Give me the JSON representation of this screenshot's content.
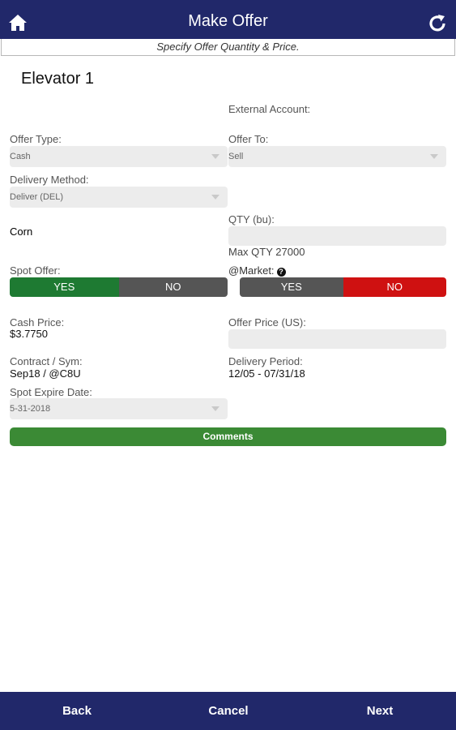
{
  "header": {
    "title": "Make Offer",
    "home_icon": "home-icon",
    "refresh_icon": "refresh-icon"
  },
  "subheader": "Specify Offer Quantity & Price.",
  "location": "Elevator 1",
  "form": {
    "external_account_label": "External Account:",
    "offer_type_label": "Offer Type:",
    "offer_type_value": "Cash",
    "offer_to_label": "Offer To:",
    "offer_to_value": "Sell",
    "delivery_method_label": "Delivery Method:",
    "delivery_method_value": "Deliver (DEL)",
    "commodity": "Corn",
    "qty_label": "QTY (bu):",
    "qty_value": "",
    "max_qty": "Max QTY 27000",
    "spot_offer_label": "Spot Offer:",
    "spot_offer_yes": "YES",
    "spot_offer_no": "NO",
    "market_label": "@Market:",
    "market_yes": "YES",
    "market_no": "NO",
    "cash_price_label": "Cash Price:",
    "cash_price_value": "$3.7750",
    "offer_price_label": "Offer Price (US):",
    "offer_price_value": "",
    "contract_label": "Contract / Sym:",
    "contract_value": "Sep18 / @C8U",
    "delivery_period_label": "Delivery Period:",
    "delivery_period_value": "12/05 - 07/31/18",
    "spot_expire_label": "Spot Expire Date:",
    "spot_expire_value": "5-31-2018",
    "comments_label": "Comments"
  },
  "footer": {
    "back": "Back",
    "cancel": "Cancel",
    "next": "Next"
  },
  "colors": {
    "navy": "#21286a",
    "selected_green": "#1e7a32",
    "selected_red": "#cf1111",
    "unselected_grey": "#555555",
    "comments_green": "#3b8a35"
  }
}
